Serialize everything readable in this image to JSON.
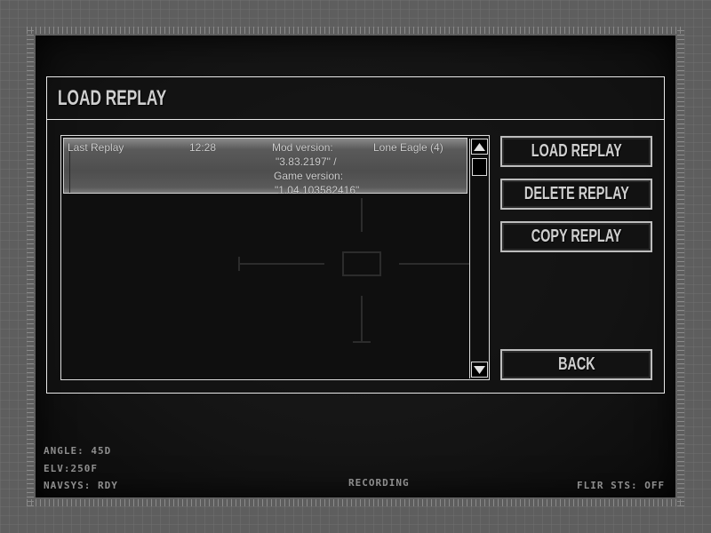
{
  "dialog": {
    "title": "LOAD REPLAY"
  },
  "replays": [
    {
      "name": "Last Replay",
      "time": "12:28",
      "mod_version_label": "Mod version:",
      "mod_version_value": "\"3.83.2197\" /",
      "game_version_label": "Game version:",
      "game_version_value": "\"1.04.103582416\"",
      "aircraft": "Lone Eagle (4)"
    }
  ],
  "buttons": {
    "load": "LOAD REPLAY",
    "delete": "DELETE REPLAY",
    "copy": "COPY REPLAY",
    "back": "BACK"
  },
  "hud": {
    "angle": "ANGLE: 45D",
    "elevation": "ELV:250F",
    "navsys": "NAVSYS: RDY",
    "recording": "RECORDING",
    "flir": "FLIR STS: OFF"
  },
  "icons": {
    "scroll_up": "triangle-up-icon",
    "scroll_down": "triangle-down-icon",
    "crosshair": "crosshair-reticle"
  },
  "colors": {
    "text": "#cfcfcf",
    "border": "#e8e8e8",
    "hud_text": "#8e8e8e",
    "row_highlight": "#5a5a5a"
  }
}
